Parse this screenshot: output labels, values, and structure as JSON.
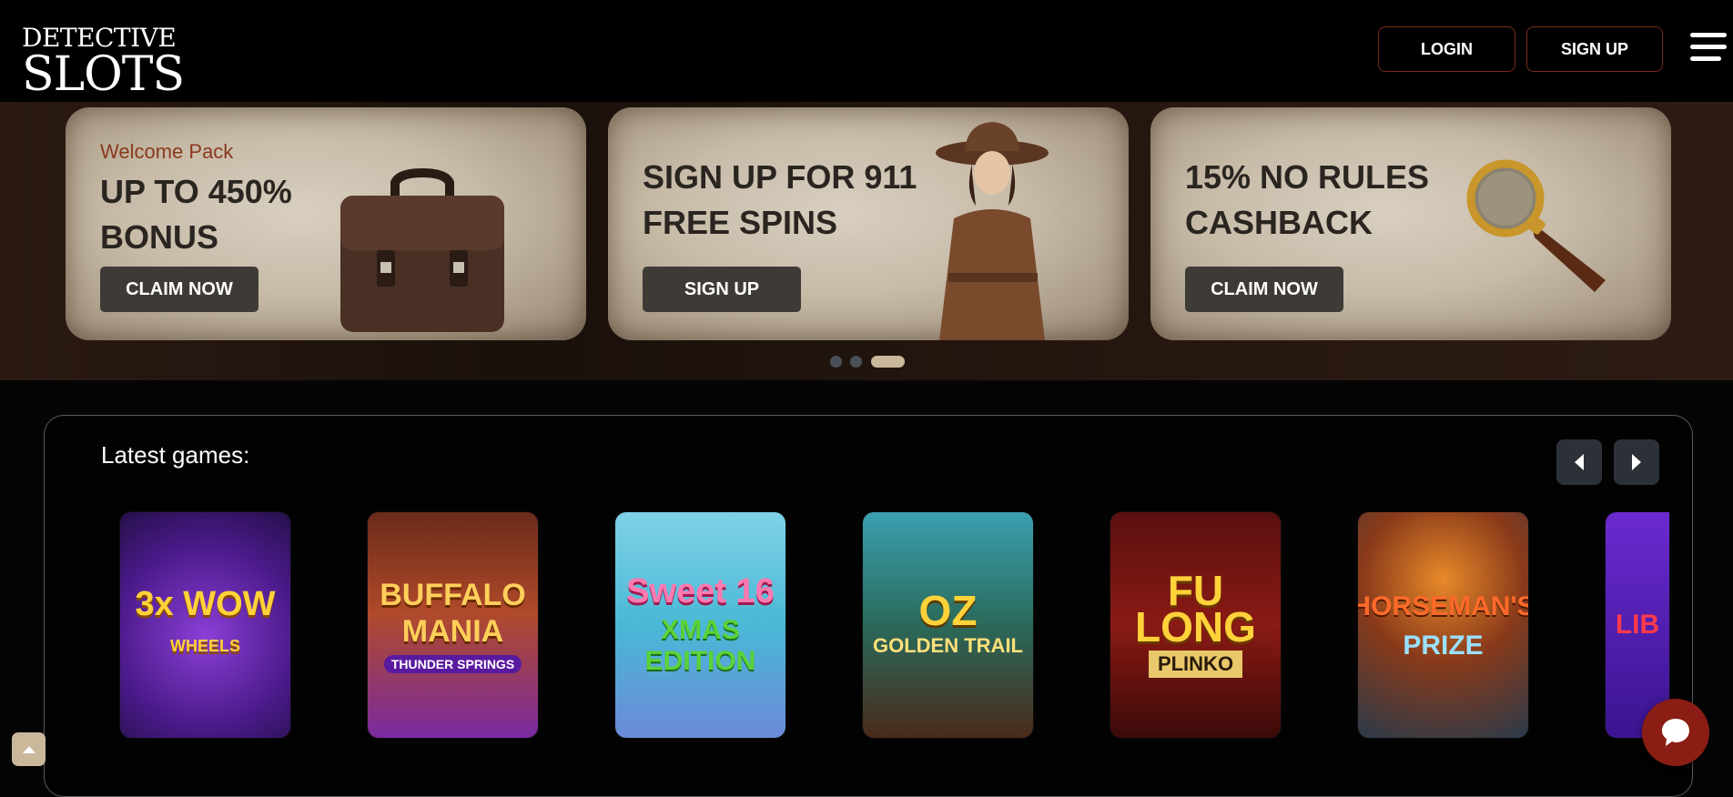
{
  "header": {
    "logo_top": "DETECTIVE",
    "logo_bottom": "SLOTS",
    "login_label": "LOGIN",
    "signup_label": "SIGN UP",
    "menu_icon": "hamburger-icon"
  },
  "promos": [
    {
      "kicker": "Welcome Pack",
      "headline": "UP TO 450% BONUS",
      "cta": "CLAIM NOW",
      "illustration": "briefcase-icon"
    },
    {
      "kicker": "",
      "headline": "SIGN UP FOR 911 FREE SPINS",
      "cta": "SIGN UP",
      "illustration": "detective-woman"
    },
    {
      "kicker": "",
      "headline": "15% NO RULES CASHBACK",
      "cta": "CLAIM NOW",
      "illustration": "magnifying-glass-icon"
    }
  ],
  "slider": {
    "dots": 3,
    "active_index": 2
  },
  "latest_games": {
    "title": "Latest games:",
    "prev_icon": "chevron-left-icon",
    "next_icon": "chevron-right-icon",
    "games": [
      {
        "title_main": "3x WOW",
        "title_sub": "WHEELS"
      },
      {
        "title_main": "BUFFALO MANIA",
        "title_sub": "THUNDER SPRINGS"
      },
      {
        "title_main": "Sweet 16",
        "title_sub": "XMAS EDITION"
      },
      {
        "title_main": "OZ",
        "title_sub": "GOLDEN TRAIL"
      },
      {
        "title_main": "FU LONG",
        "title_sub": "PLINKO"
      },
      {
        "title_main": "HORSEMAN'S",
        "title_sub": "PRIZE"
      },
      {
        "title_main": "LIB",
        "title_sub": ""
      }
    ]
  },
  "colors": {
    "accent_border": "#7a2a1a",
    "cta_bg": "#3e3a36",
    "kicker": "#8a3a1e",
    "active_dot": "#c9b89a",
    "chat_bg": "#8a1e14"
  },
  "floating": {
    "scroll_top_icon": "arrow-up-icon",
    "chat_icon": "chat-bubble-icon"
  }
}
